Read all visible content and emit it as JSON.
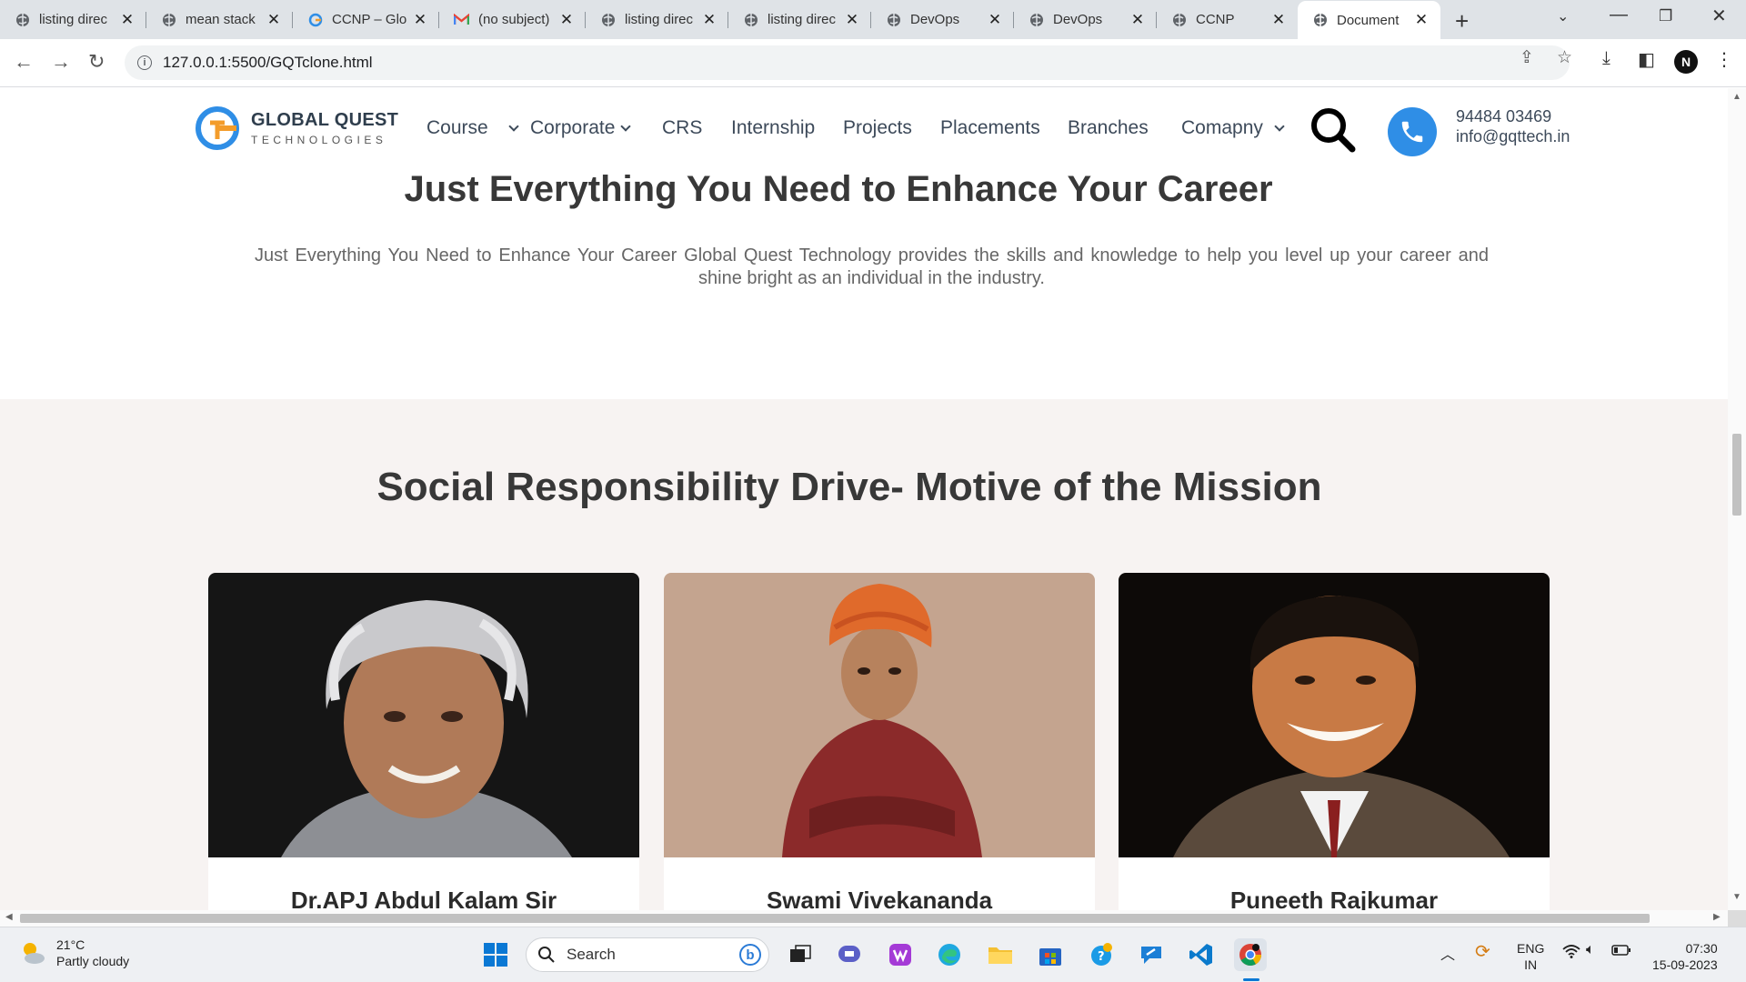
{
  "browser": {
    "tabs": [
      {
        "title": "listing direc",
        "icon": "globe-icon",
        "active": false
      },
      {
        "title": "mean stack",
        "icon": "globe-icon",
        "active": false
      },
      {
        "title": "CCNP – Glo",
        "icon": "gqt-icon",
        "active": false
      },
      {
        "title": "(no subject)",
        "icon": "gmail-icon",
        "active": false
      },
      {
        "title": "listing direc",
        "icon": "globe-icon",
        "active": false
      },
      {
        "title": "listing direc",
        "icon": "globe-icon",
        "active": false
      },
      {
        "title": "DevOps",
        "icon": "globe-icon",
        "active": false
      },
      {
        "title": "DevOps",
        "icon": "globe-icon",
        "active": false
      },
      {
        "title": "CCNP",
        "icon": "globe-icon",
        "active": false
      },
      {
        "title": "Document",
        "icon": "globe-icon",
        "active": true
      }
    ],
    "url": "127.0.0.1:5500/GQTclone.html",
    "profile_initial": "N"
  },
  "site": {
    "logo_name": "GLOBAL QUEST",
    "logo_sub": "TECHNOLOGIES",
    "menu": [
      {
        "label": "Course",
        "dropdown": false
      },
      {
        "label": "Corporate",
        "dropdown": true
      },
      {
        "label": "CRS",
        "dropdown": false
      },
      {
        "label": "Internship",
        "dropdown": false
      },
      {
        "label": "Projects",
        "dropdown": false
      },
      {
        "label": "Placements",
        "dropdown": false
      },
      {
        "label": "Branches",
        "dropdown": false
      },
      {
        "label": "Comapny",
        "dropdown": true
      }
    ],
    "phone": "94484 03469",
    "email": "info@gqttech.in"
  },
  "career": {
    "title": "Just Everything You Need to Enhance Your Career",
    "text": "Just Everything You Need to Enhance Your Career Global Quest Technology provides the skills and knowledge to help you level up your career and shine bright as an individual in the industry."
  },
  "mission": {
    "title": "Social Responsibility Drive- Motive of the Mission",
    "cards": [
      {
        "name": "Dr.APJ Abdul Kalam Sir"
      },
      {
        "name": "Swami Vivekananda"
      },
      {
        "name": "Puneeth Rajkumar"
      }
    ]
  },
  "taskbar": {
    "weather_temp": "21°C",
    "weather_desc": "Partly cloudy",
    "search_label": "Search",
    "lang_top": "ENG",
    "lang_bottom": "IN",
    "time": "07:30",
    "date": "15-09-2023"
  },
  "colors": {
    "accent_blue": "#2f8ee6",
    "logo_orange": "#f39c2b",
    "mission_bg": "#f7f3f2"
  }
}
